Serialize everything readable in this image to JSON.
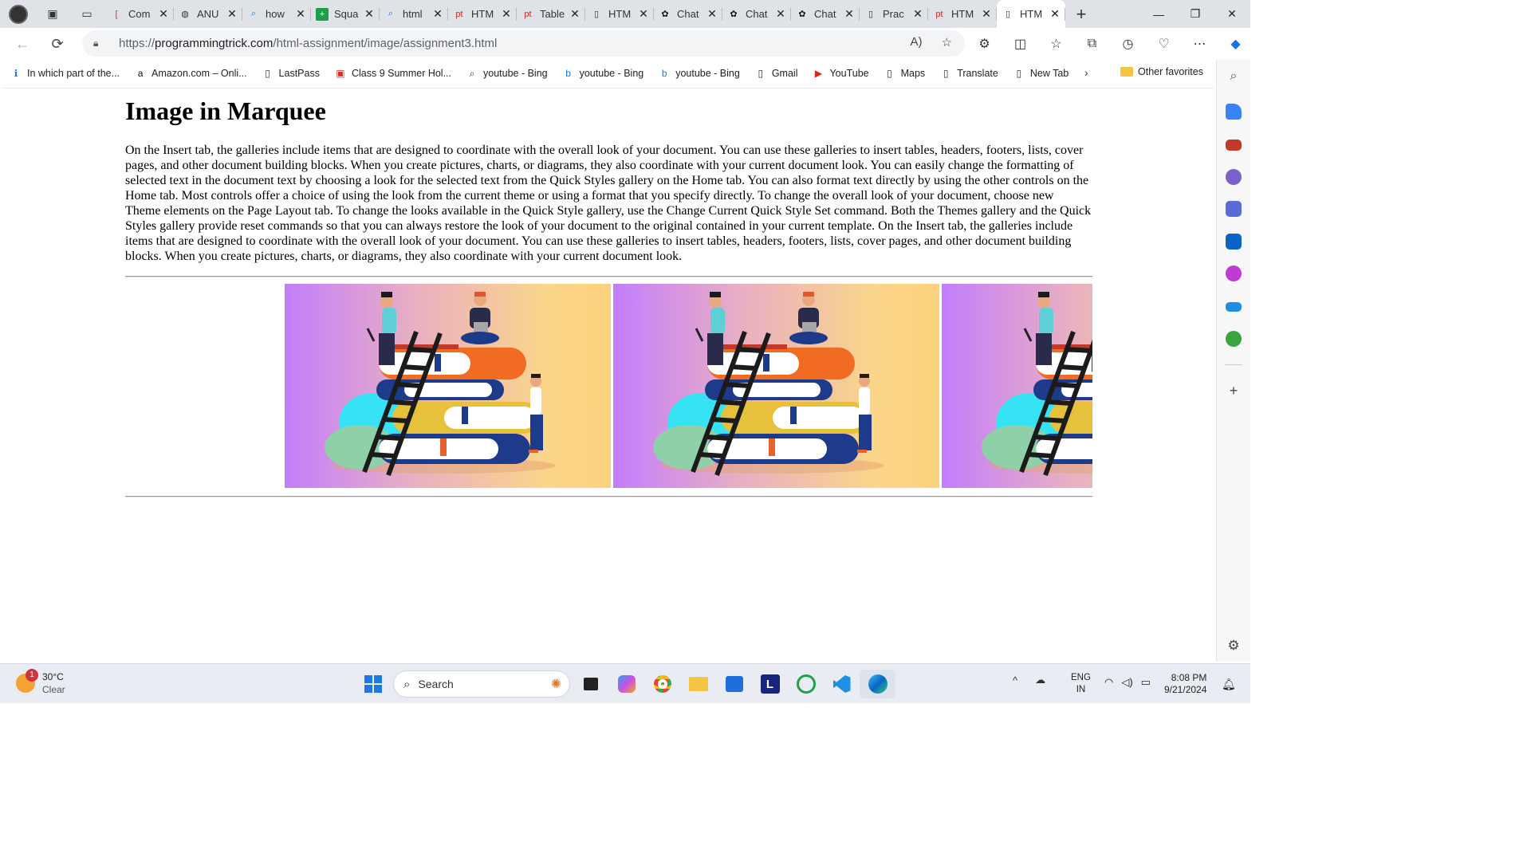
{
  "browser": {
    "tabs": [
      {
        "title": "Com",
        "favicon": "red-bracket-icon"
      },
      {
        "title": "ANU",
        "favicon": "shield-icon"
      },
      {
        "title": "how",
        "favicon": "search-icon"
      },
      {
        "title": "Squa",
        "favicon": "green-plus-icon"
      },
      {
        "title": "html",
        "favicon": "search-icon"
      },
      {
        "title": "HTM",
        "favicon": "pt-icon"
      },
      {
        "title": "Table",
        "favicon": "pt-icon"
      },
      {
        "title": "HTM",
        "favicon": "page-icon"
      },
      {
        "title": "Chat",
        "favicon": "chatgpt-icon"
      },
      {
        "title": "Chat",
        "favicon": "chatgpt-icon"
      },
      {
        "title": "Chat",
        "favicon": "chatgpt-icon"
      },
      {
        "title": "Prac",
        "favicon": "page-icon"
      },
      {
        "title": "HTM",
        "favicon": "pt-icon"
      },
      {
        "title": "HTM",
        "favicon": "page-icon",
        "active": true
      }
    ],
    "address": {
      "scheme": "https://",
      "host": "programmingtrick.com",
      "path": "/html-assignment/image/assignment3.html"
    },
    "favorites": [
      {
        "label": "In which part of the...",
        "icon": "info-icon"
      },
      {
        "label": "Amazon.com – Onli...",
        "icon": "amazon-icon"
      },
      {
        "label": "LastPass",
        "icon": "page-icon"
      },
      {
        "label": "Class 9 Summer Hol...",
        "icon": "pdf-icon"
      },
      {
        "label": "youtube - Bing",
        "icon": "search-icon"
      },
      {
        "label": "youtube - Bing",
        "icon": "bing-icon"
      },
      {
        "label": "youtube - Bing",
        "icon": "bing-icon"
      },
      {
        "label": "Gmail",
        "icon": "page-icon"
      },
      {
        "label": "YouTube",
        "icon": "youtube-icon"
      },
      {
        "label": "Maps",
        "icon": "page-icon"
      },
      {
        "label": "Translate",
        "icon": "page-icon"
      },
      {
        "label": "New Tab",
        "icon": "page-icon"
      }
    ],
    "other_favorites": "Other favorites"
  },
  "page": {
    "heading": "Image in Marquee",
    "paragraph": "On the Insert tab, the galleries include items that are designed to coordinate with the overall look of your document. You can use these galleries to insert tables, headers, footers, lists, cover pages, and other document building blocks. When you create pictures, charts, or diagrams, they also coordinate with your current document look. You can easily change the formatting of selected text in the document text by choosing a look for the selected text from the Quick Styles gallery on the Home tab. You can also format text directly by using the other controls on the Home tab. Most controls offer a choice of using the look from the current theme or using a format that you specify directly. To change the overall look of your document, choose new Theme elements on the Page Layout tab. To change the looks available in the Quick Style gallery, use the Change Current Quick Style Set command. Both the Themes gallery and the Quick Styles gallery provide reset commands so that you can always restore the look of your document to the original contained in your current template. On the Insert tab, the galleries include items that are designed to coordinate with the overall look of your document. You can use these galleries to insert tables, headers, footers, lists, cover pages, and other document building blocks. When you create pictures, charts, or diagrams, they also coordinate with your current document look.",
    "marquee_images": [
      "books-illustration",
      "books-illustration",
      "books-illustration"
    ]
  },
  "taskbar": {
    "weather_temp": "30°C",
    "weather_desc": "Clear",
    "weather_badge": "1",
    "search_placeholder": "Search",
    "lang_line1": "ENG",
    "lang_line2": "IN",
    "time": "8:08 PM",
    "date": "9/21/2024"
  },
  "colors": {
    "gradient_left": "#c47dfc",
    "gradient_right": "#fcd27c",
    "edge_accent": "#0a64c8"
  }
}
